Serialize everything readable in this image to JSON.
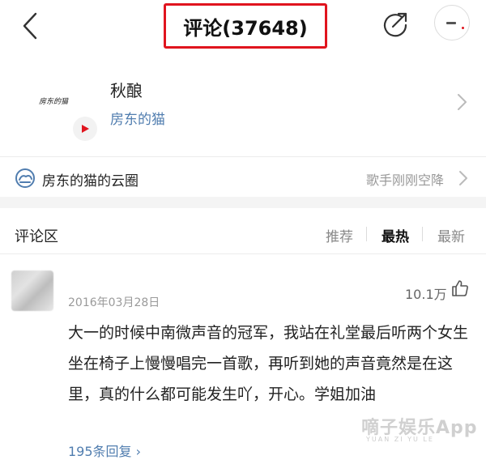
{
  "header": {
    "title": "评论(37648)"
  },
  "song": {
    "title": "秋酿",
    "artist": "房东的猫",
    "cover_text": "房东的猫"
  },
  "circle": {
    "label": "房东的猫的云圈",
    "status": "歌手刚刚空降"
  },
  "comments_section": {
    "title": "评论区",
    "sort_tabs": [
      "推荐",
      "最热",
      "最新"
    ],
    "active_tab": "最热"
  },
  "comment": {
    "date": "2016年03月28日",
    "likes": "10.1万",
    "text": "大一的时候中南微声音的冠军，我站在礼堂最后听两个女生坐在椅子上慢慢唱完一首歌，再听到她的声音竟然是在这里，真的什么都可能发生吖，开心。学姐加油",
    "replies": "195条回复 ›"
  },
  "watermark": {
    "main": "嘀子娱乐App",
    "sub": "YUAN ZI YU LE"
  },
  "colors": {
    "accent_red": "#e0141e",
    "link_blue": "#507daf"
  }
}
